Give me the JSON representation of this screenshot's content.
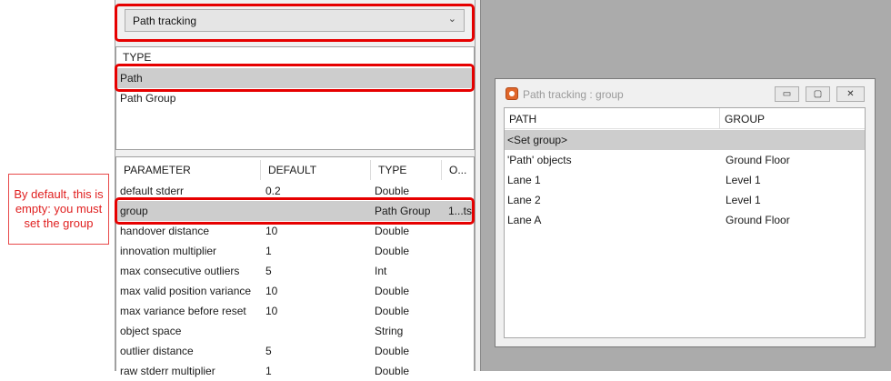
{
  "annotation": {
    "text": "By default, this is empty: you must set the group"
  },
  "type_dropdown": {
    "value": "Path tracking",
    "chevron_icon": "chevron-down-icon"
  },
  "type_list": {
    "header": "TYPE",
    "items": [
      {
        "label": "Path",
        "selected": true
      },
      {
        "label": "Path Group",
        "selected": false
      }
    ]
  },
  "parameters": {
    "columns": [
      "PARAMETER",
      "DEFAULT",
      "TYPE",
      "O..."
    ],
    "rows": [
      {
        "parameter": "default stderr",
        "default": "0.2",
        "type": "Double",
        "other": ""
      },
      {
        "parameter": "group",
        "default": "",
        "type": "Path Group",
        "other": "1...ts",
        "selected": true
      },
      {
        "parameter": "handover distance",
        "default": "10",
        "type": "Double",
        "other": ""
      },
      {
        "parameter": "innovation multiplier",
        "default": "1",
        "type": "Double",
        "other": ""
      },
      {
        "parameter": "max consecutive outliers",
        "default": "5",
        "type": "Int",
        "other": ""
      },
      {
        "parameter": "max valid position variance",
        "default": "10",
        "type": "Double",
        "other": ""
      },
      {
        "parameter": "max variance before reset",
        "default": "10",
        "type": "Double",
        "other": ""
      },
      {
        "parameter": "object space",
        "default": "",
        "type": "String",
        "other": ""
      },
      {
        "parameter": "outlier distance",
        "default": "5",
        "type": "Double",
        "other": ""
      },
      {
        "parameter": "raw stderr multiplier",
        "default": "1",
        "type": "Double",
        "other": ""
      }
    ]
  },
  "group_window": {
    "title": "Path tracking : group",
    "buttons": {
      "minimize": "▭",
      "maximize": "▢",
      "close": "✕"
    },
    "columns": [
      "PATH",
      "GROUP"
    ],
    "rows": [
      {
        "path": "<Set group>",
        "group": "",
        "selected": true
      },
      {
        "path": "'Path' objects",
        "group": "Ground Floor"
      },
      {
        "path": "Lane 1",
        "group": "Level 1"
      },
      {
        "path": "Lane 2",
        "group": "Level 1"
      },
      {
        "path": "Lane A",
        "group": "Ground Floor"
      }
    ]
  },
  "colors": {
    "highlight": "#e60000",
    "selection": "#cdcdcd",
    "workspace": "#ababab",
    "annotation_text": "#e02020"
  }
}
